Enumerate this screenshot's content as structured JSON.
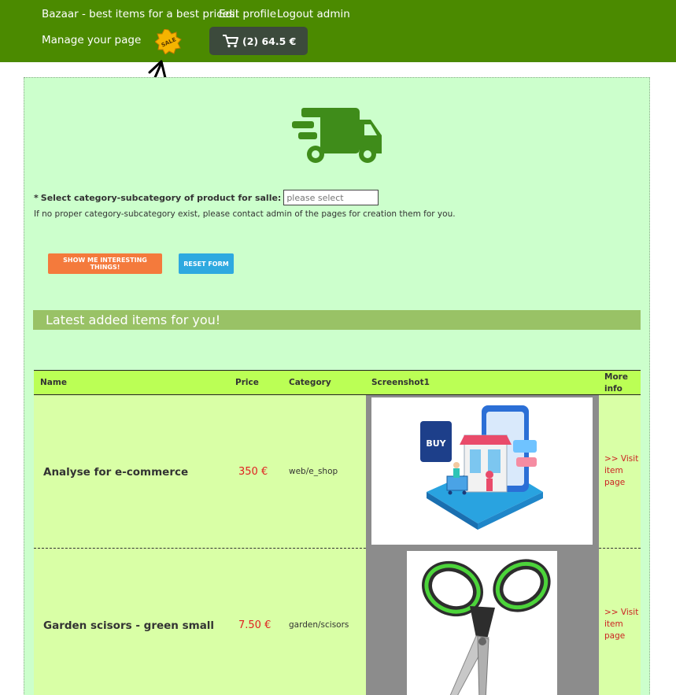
{
  "nav": {
    "brand": "Bazaar - best items for a best prices!",
    "edit_profile": "Edit profile",
    "logout": "Logout admin",
    "manage": "Manage your page",
    "sale_badge": "SALE",
    "cart_label": "(2) 64.5 €"
  },
  "form": {
    "required_mark": "*",
    "category_label": "Select category-subcategory of product for salle:",
    "category_placeholder": "please select",
    "hint": "If no proper category-subcategory exist, please contact admin of the pages for creation them for you.",
    "show_button": "SHOW ME INTERESTING THINGS!",
    "reset_button": "RESET FORM"
  },
  "latest": {
    "heading": "Latest added items for you!"
  },
  "table": {
    "headers": {
      "name": "Name",
      "price": "Price",
      "category": "Category",
      "screenshot": "Screenshot1",
      "more_info_1": "More",
      "more_info_2": "info"
    },
    "rows": [
      {
        "name": "Analyse for e-commerce",
        "price": "350 €",
        "category": "web/e_shop",
        "visit_1": ">> Visit",
        "visit_2": "item",
        "visit_3": "page"
      },
      {
        "name": "Garden scisors - green small",
        "price": "7.50 €",
        "category": "garden/scisors",
        "visit_1": ">> Visit",
        "visit_2": "item",
        "visit_3": "page"
      }
    ]
  },
  "colors": {
    "topbar": "#4b8a00",
    "panel": "#ccffcc",
    "header_row": "#bbff55",
    "data_row": "#d9ffa6",
    "price": "#e02020"
  }
}
